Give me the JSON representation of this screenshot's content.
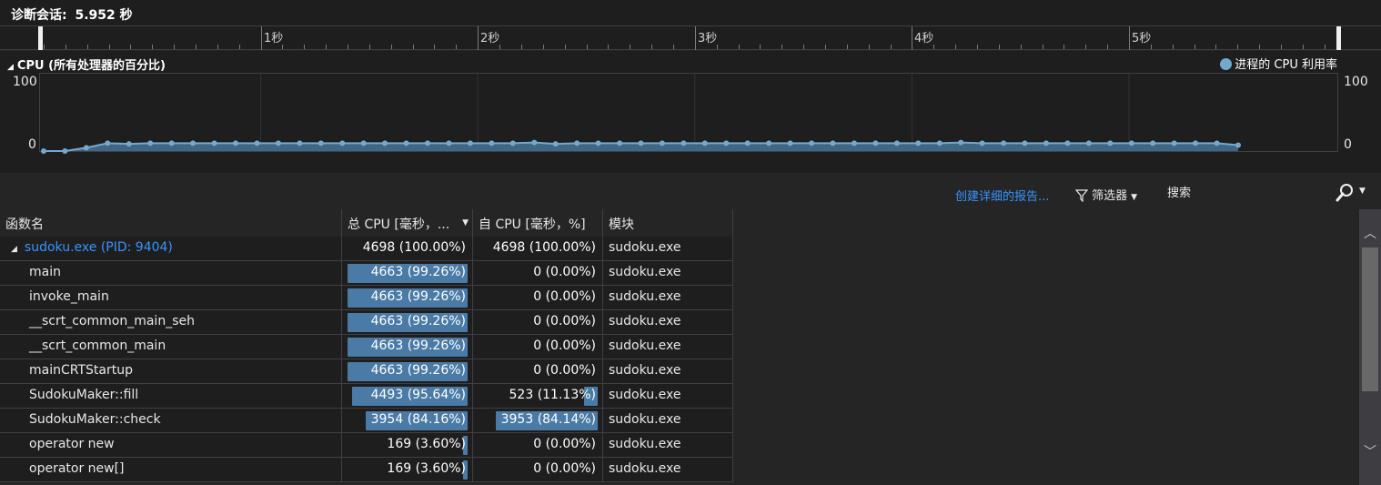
{
  "session": {
    "label": "诊断会话:",
    "duration": "5.952 秒"
  },
  "ruler": {
    "labels": [
      "1秒",
      "2秒",
      "3秒",
      "4秒",
      "5秒"
    ]
  },
  "cpu_graph": {
    "title": "CPU (所有处理器的百分比)",
    "legend": "进程的 CPU 利用率",
    "y_max_label": "100",
    "y_min_label": "0",
    "accent_color": "#74a9cf"
  },
  "chart_data": {
    "type": "area",
    "title": "CPU (所有处理器的百分比)",
    "series": [
      {
        "name": "进程的 CPU 利用率",
        "values": [
          0,
          0,
          5,
          12,
          11,
          12,
          12,
          12,
          12,
          12,
          12,
          12,
          12,
          12,
          12,
          12,
          12,
          12,
          12,
          12,
          12,
          12,
          12,
          13,
          11,
          12,
          12,
          12,
          12,
          12,
          12,
          12,
          12,
          12,
          12,
          12,
          12,
          12,
          12,
          12,
          12,
          12,
          12,
          13,
          12,
          12,
          12,
          12,
          12,
          12,
          12,
          12,
          12,
          12,
          12,
          12,
          9
        ]
      }
    ],
    "ylim": [
      0,
      100
    ]
  },
  "toolbar": {
    "report_link": "创建详细的报告...",
    "filter_label": "筛选器",
    "search_placeholder": "搜索"
  },
  "table": {
    "headers": [
      "函数名",
      "总 CPU [毫秒，...",
      "自 CPU [毫秒，%]",
      "模块"
    ],
    "rows": [
      {
        "name": "sudoku.exe (PID: 9404)",
        "total": "4698 (100.00%)",
        "total_pct": 100.0,
        "self": "4698 (100.00%)",
        "self_pct": 100.0,
        "module": "sudoku.exe",
        "root": true
      },
      {
        "name": "main",
        "total": "4663 (99.26%)",
        "total_pct": 99.26,
        "self": "0 (0.00%)",
        "self_pct": 0.0,
        "module": "sudoku.exe"
      },
      {
        "name": "invoke_main",
        "total": "4663 (99.26%)",
        "total_pct": 99.26,
        "self": "0 (0.00%)",
        "self_pct": 0.0,
        "module": "sudoku.exe"
      },
      {
        "name": "__scrt_common_main_seh",
        "total": "4663 (99.26%)",
        "total_pct": 99.26,
        "self": "0 (0.00%)",
        "self_pct": 0.0,
        "module": "sudoku.exe"
      },
      {
        "name": "__scrt_common_main",
        "total": "4663 (99.26%)",
        "total_pct": 99.26,
        "self": "0 (0.00%)",
        "self_pct": 0.0,
        "module": "sudoku.exe"
      },
      {
        "name": "mainCRTStartup",
        "total": "4663 (99.26%)",
        "total_pct": 99.26,
        "self": "0 (0.00%)",
        "self_pct": 0.0,
        "module": "sudoku.exe"
      },
      {
        "name": "SudokuMaker::fill",
        "total": "4493 (95.64%)",
        "total_pct": 95.64,
        "self": "523 (11.13%)",
        "self_pct": 11.13,
        "module": "sudoku.exe"
      },
      {
        "name": "SudokuMaker::check",
        "total": "3954 (84.16%)",
        "total_pct": 84.16,
        "self": "3953 (84.14%)",
        "self_pct": 84.14,
        "module": "sudoku.exe"
      },
      {
        "name": "operator new",
        "total": "169 (3.60%)",
        "total_pct": 3.6,
        "self": "0 (0.00%)",
        "self_pct": 0.0,
        "module": "sudoku.exe"
      },
      {
        "name": "operator new[]",
        "total": "169 (3.60%)",
        "total_pct": 3.6,
        "self": "0 (0.00%)",
        "self_pct": 0.0,
        "module": "sudoku.exe"
      }
    ]
  }
}
